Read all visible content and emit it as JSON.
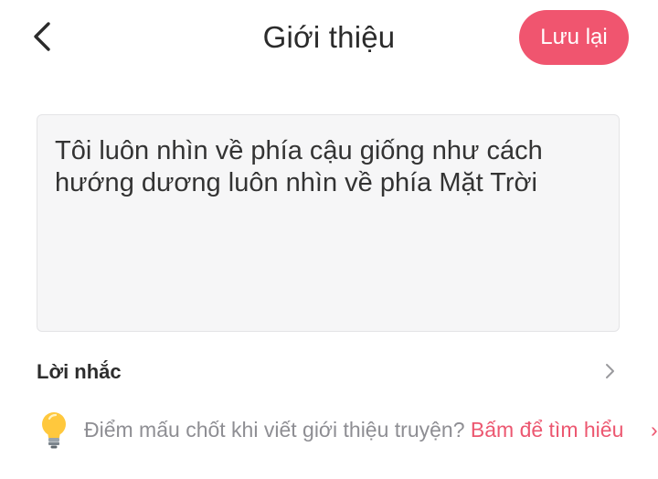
{
  "header": {
    "title": "Giới thiệu",
    "save_label": "Lưu lại",
    "back_icon": "chevron-left-icon"
  },
  "intro": {
    "text": "Tôi luôn nhìn về phía cậu giống như cách\nhướng dương luôn nhìn về phía Mặt Trời"
  },
  "reminder": {
    "label": "Lời nhắc",
    "icon": "chevron-right-icon"
  },
  "tip": {
    "icon": "lightbulb-icon",
    "text": "Điểm mấu chốt khi viết giới thiệu truyện? ",
    "link": "Bấm để tìm hiểu",
    "more": "›"
  },
  "colors": {
    "accent": "#f0556f",
    "link": "#ec5770",
    "muted_text": "#8e8e93",
    "input_bg": "#f6f6f7"
  }
}
